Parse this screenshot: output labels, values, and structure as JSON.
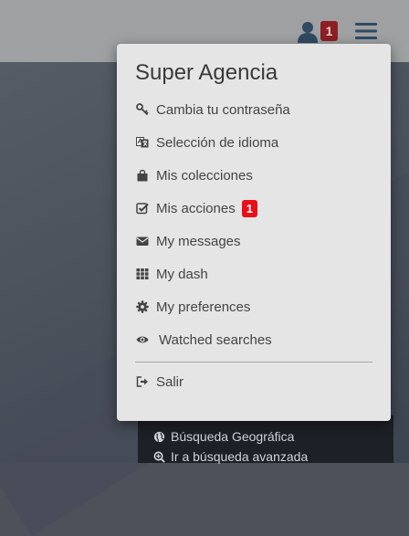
{
  "header": {
    "user_icon": "user-icon",
    "notification_count": "1",
    "menu_icon": "hamburger-icon"
  },
  "background_links": [
    {
      "icon": "globe-icon",
      "label": "Búsqueda Geográfica"
    },
    {
      "icon": "search-plus-icon",
      "label": "Ir a búsqueda avanzada"
    }
  ],
  "menu": {
    "title": "Super Agencia",
    "items": [
      {
        "icon": "key-icon",
        "label": "Cambia tu contraseña"
      },
      {
        "icon": "language-icon",
        "label": "Selección de idioma"
      },
      {
        "icon": "shopping-bag-icon",
        "label": "Mis colecciones"
      },
      {
        "icon": "check-square-icon",
        "label": "Mis acciones",
        "badge": "1"
      },
      {
        "icon": "envelope-icon",
        "label": "My messages"
      },
      {
        "icon": "grid-icon",
        "label": "My dash"
      },
      {
        "icon": "gear-icon",
        "label": "My preferences"
      },
      {
        "icon": "eye-icon",
        "label": "Watched searches"
      }
    ],
    "logout": {
      "icon": "sign-out-icon",
      "label": "Salir"
    }
  },
  "colors": {
    "accent_dark": "#2f4a63",
    "badge_red": "#e8101b",
    "menu_bg": "#e5e5e5"
  }
}
